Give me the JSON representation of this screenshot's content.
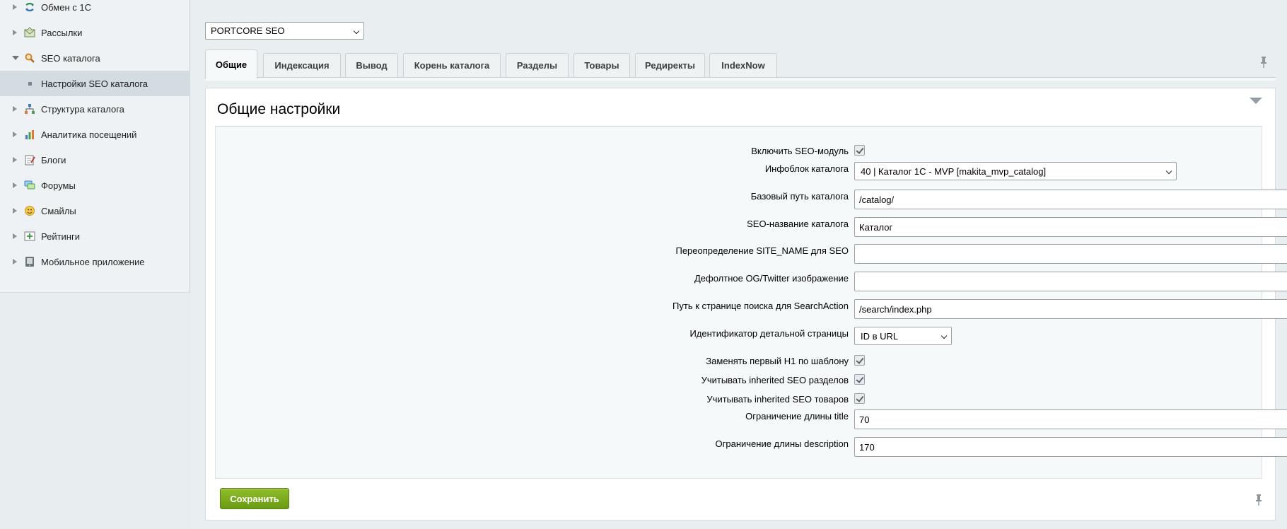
{
  "sidebar": {
    "items": [
      {
        "label": "Обмен с 1С",
        "icon": "exchange-icon"
      },
      {
        "label": "Рассылки",
        "icon": "mail-icon"
      },
      {
        "label": "SEO каталога",
        "icon": "seo-search-icon"
      },
      {
        "label": "Настройки SEO каталога",
        "icon": "bullet"
      },
      {
        "label": "Структура каталога",
        "icon": "structure-icon"
      },
      {
        "label": "Аналитика посещений",
        "icon": "analytics-icon"
      },
      {
        "label": "Блоги",
        "icon": "blog-icon"
      },
      {
        "label": "Форумы",
        "icon": "forum-icon"
      },
      {
        "label": "Смайлы",
        "icon": "smile-icon"
      },
      {
        "label": "Рейтинги",
        "icon": "rating-icon"
      },
      {
        "label": "Мобильное приложение",
        "icon": "mobile-app-icon"
      }
    ]
  },
  "site_select": {
    "value": "PORTCORE SEO"
  },
  "tabs": [
    "Общие",
    "Индексация",
    "Вывод",
    "Корень каталога",
    "Разделы",
    "Товары",
    "Редиректы",
    "IndexNow"
  ],
  "active_tab": "Общие",
  "panel": {
    "title": "Общие настройки"
  },
  "form": {
    "enable_seo_label": "Включить SEO-модуль",
    "enable_seo_checked": true,
    "iblock_label": "Инфоблок каталога",
    "iblock_value": "40 | Каталог 1С - MVP [makita_mvp_catalog]",
    "base_path_label": "Базовый путь каталога",
    "base_path_value": "/catalog/",
    "seo_name_label": "SEO-название каталога",
    "seo_name_value": "Каталог",
    "site_name_label": "Переопределение SITE_NAME для SEO",
    "site_name_value": "",
    "og_image_label": "Дефолтное OG/Twitter изображение",
    "og_image_value": "",
    "search_path_label": "Путь к странице поиска для SearchAction",
    "search_path_value": "/search/index.php",
    "detail_id_label": "Идентификатор детальной страницы",
    "detail_id_value": "ID в URL",
    "replace_h1_label": "Заменять первый H1 по шаблону",
    "replace_h1_checked": true,
    "inherit_sections_label": "Учитывать inherited SEO разделов",
    "inherit_sections_checked": true,
    "inherit_products_label": "Учитывать inherited SEO товаров",
    "inherit_products_checked": true,
    "title_limit_label": "Ограничение длины title",
    "title_limit_value": "70",
    "desc_limit_label": "Ограничение длины description",
    "desc_limit_value": "170"
  },
  "save_label": "Сохранить",
  "colors": {
    "accent_green": "#6a9a12",
    "sidebar_active": "#d2dce1"
  }
}
